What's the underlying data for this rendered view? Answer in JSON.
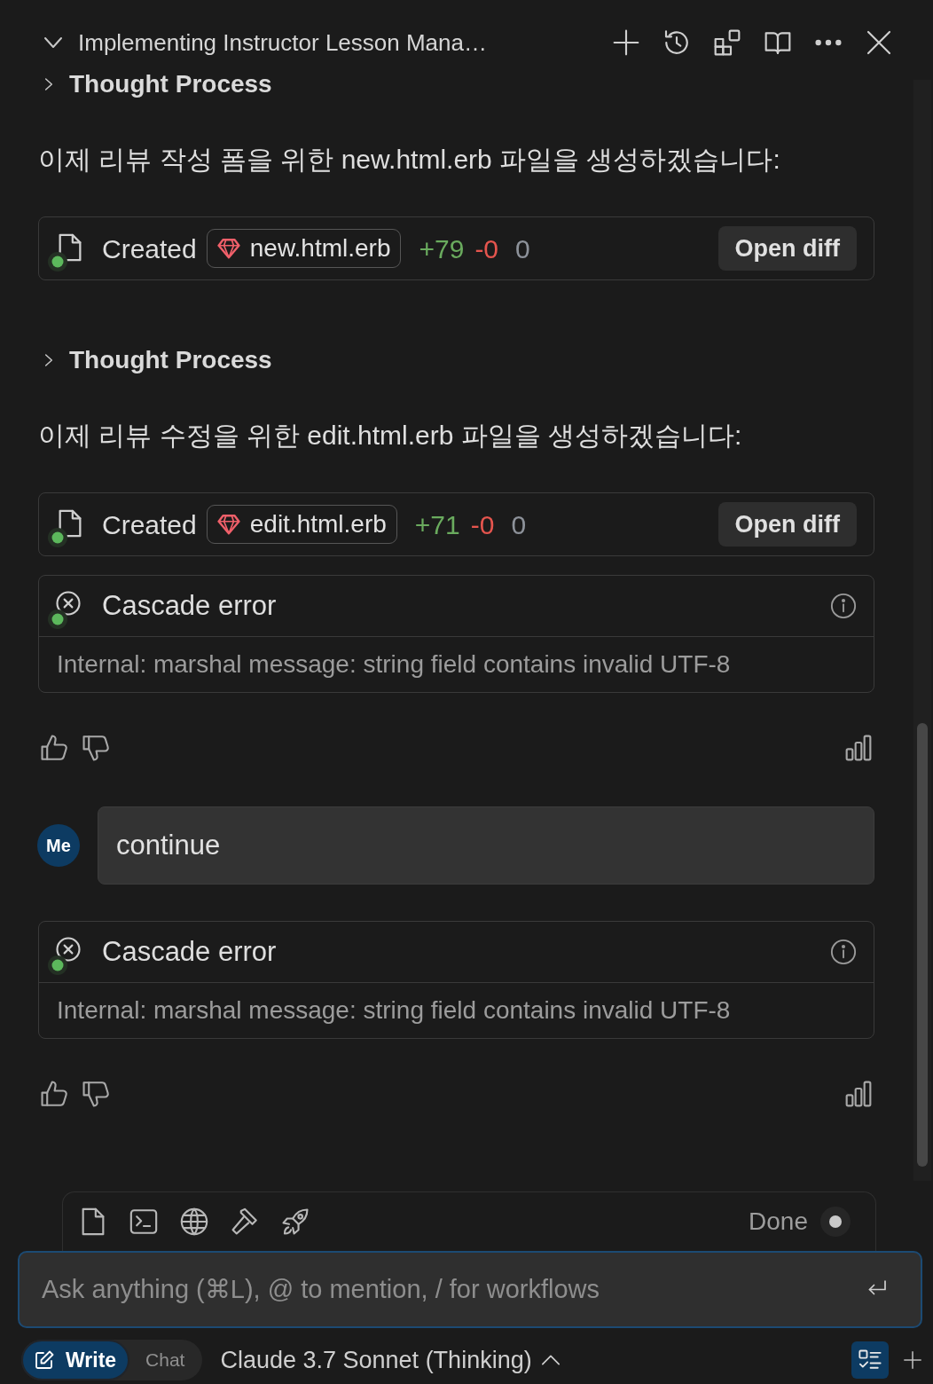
{
  "header": {
    "title": "Implementing Instructor Lesson Mana…",
    "expanded": true
  },
  "conversation": [
    {
      "kind": "thought",
      "label": "Thought Process",
      "expanded": false
    },
    {
      "kind": "text",
      "text": "이제 리뷰 작성 폼을 위한 new.html.erb 파일을 생성하겠습니다:"
    },
    {
      "kind": "file",
      "action": "Created",
      "filename": "new.html.erb",
      "added": "+79",
      "removed": "-0",
      "extra_count": "0",
      "button": "Open diff"
    },
    {
      "kind": "thought",
      "label": "Thought Process",
      "expanded": false
    },
    {
      "kind": "text",
      "text": "이제 리뷰 수정을 위한 edit.html.erb 파일을 생성하겠습니다:"
    },
    {
      "kind": "file",
      "action": "Created",
      "filename": "edit.html.erb",
      "added": "+71",
      "removed": "-0",
      "extra_count": "0",
      "button": "Open diff"
    },
    {
      "kind": "error",
      "title": "Cascade error",
      "detail": "Internal: marshal message: string field contains invalid UTF-8"
    },
    {
      "kind": "feedback"
    },
    {
      "kind": "user",
      "avatar": "Me",
      "text": "continue"
    },
    {
      "kind": "error",
      "title": "Cascade error",
      "detail": "Internal: marshal message: string field contains invalid UTF-8"
    },
    {
      "kind": "feedback"
    }
  ],
  "composer": {
    "status": "Done",
    "placeholder": "Ask anything (⌘L), @ to mention, / for workflows",
    "modes": [
      {
        "label": "Write",
        "selected": true
      },
      {
        "label": "Chat",
        "selected": false
      }
    ],
    "model": "Claude 3.7 Sonnet (Thinking)"
  }
}
